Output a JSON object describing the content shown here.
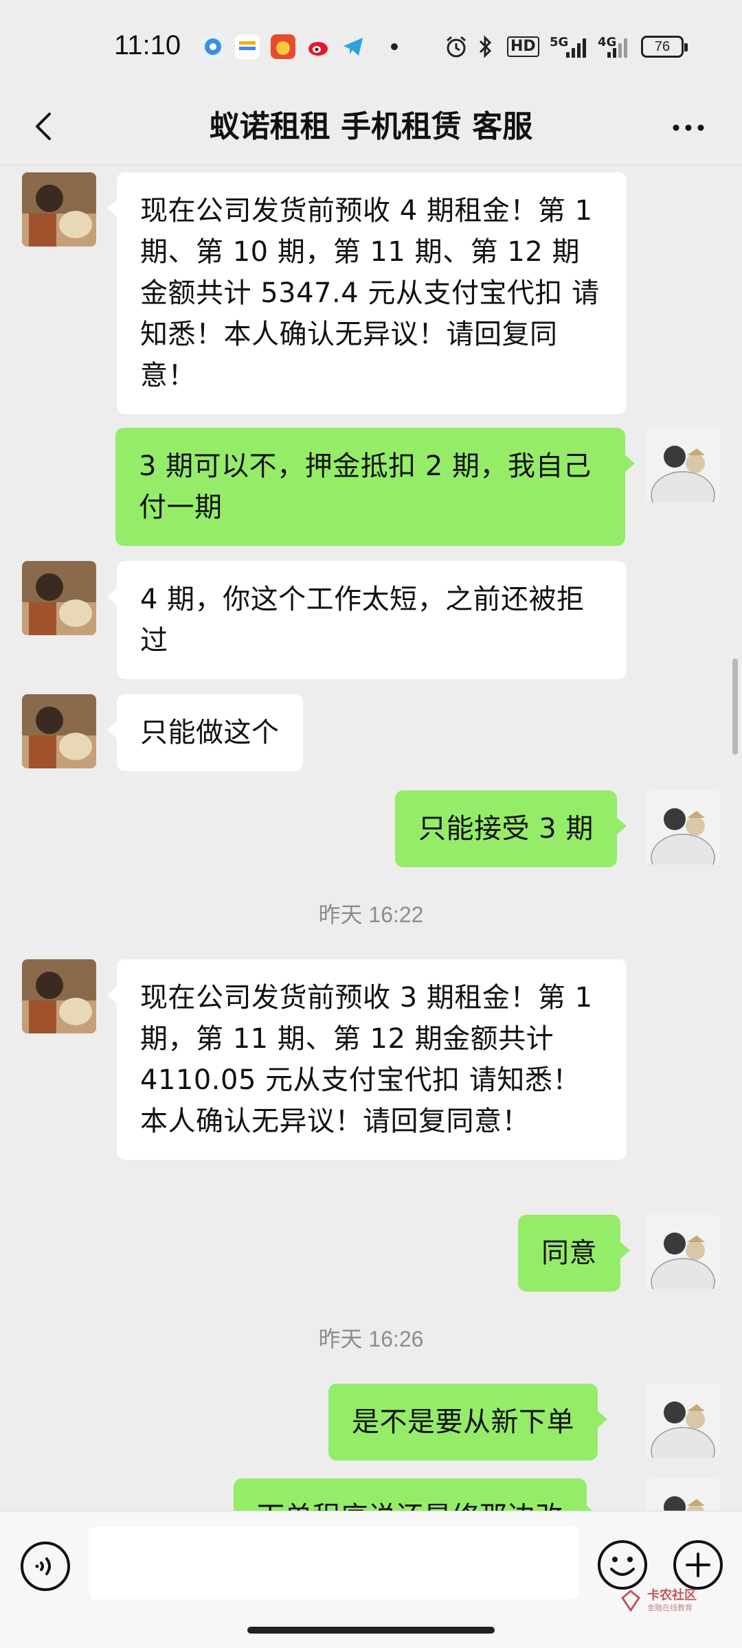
{
  "status_bar": {
    "time": "11:10",
    "battery": "76",
    "network": "5G",
    "network2": "4G",
    "hd": "HD"
  },
  "header": {
    "title": "蚁诺租租 手机租赁 客服"
  },
  "messages": [
    {
      "side": "in",
      "text": "现在公司发货前预收 4 期租金！第 1 期、第 10 期，第 11 期、第 12 期金额共计 5347.4 元从支付宝代扣 请知悉！本人确认无异议！请回复同意！"
    },
    {
      "side": "out",
      "text": "3 期可以不，押金抵扣 2 期，我自己付一期"
    },
    {
      "side": "in",
      "text": "4 期，你这个工作太短，之前还被拒过"
    },
    {
      "side": "in",
      "text": "只能做这个"
    },
    {
      "side": "out",
      "text": "只能接受 3 期"
    },
    {
      "side": "in",
      "text": "现在公司发货前预收 3 期租金！第 1 期，第 11 期、第 12 期金额共计 4110.05 元从支付宝代扣 请知悉！本人确认无异议！请回复同意！"
    },
    {
      "side": "out",
      "text": "同意"
    },
    {
      "side": "out",
      "text": "是不是要从新下单"
    },
    {
      "side": "out",
      "text": "下单程序说还是修那边改"
    }
  ],
  "timestamps": [
    "昨天 16:22",
    "昨天 16:26"
  ],
  "input": {
    "placeholder": ""
  },
  "watermark": {
    "title": "卡农社区",
    "subtitle": "金融在线教育"
  },
  "colors": {
    "outgoing_bubble": "#95ec69",
    "incoming_bubble": "#ffffff",
    "background": "#ededed"
  }
}
